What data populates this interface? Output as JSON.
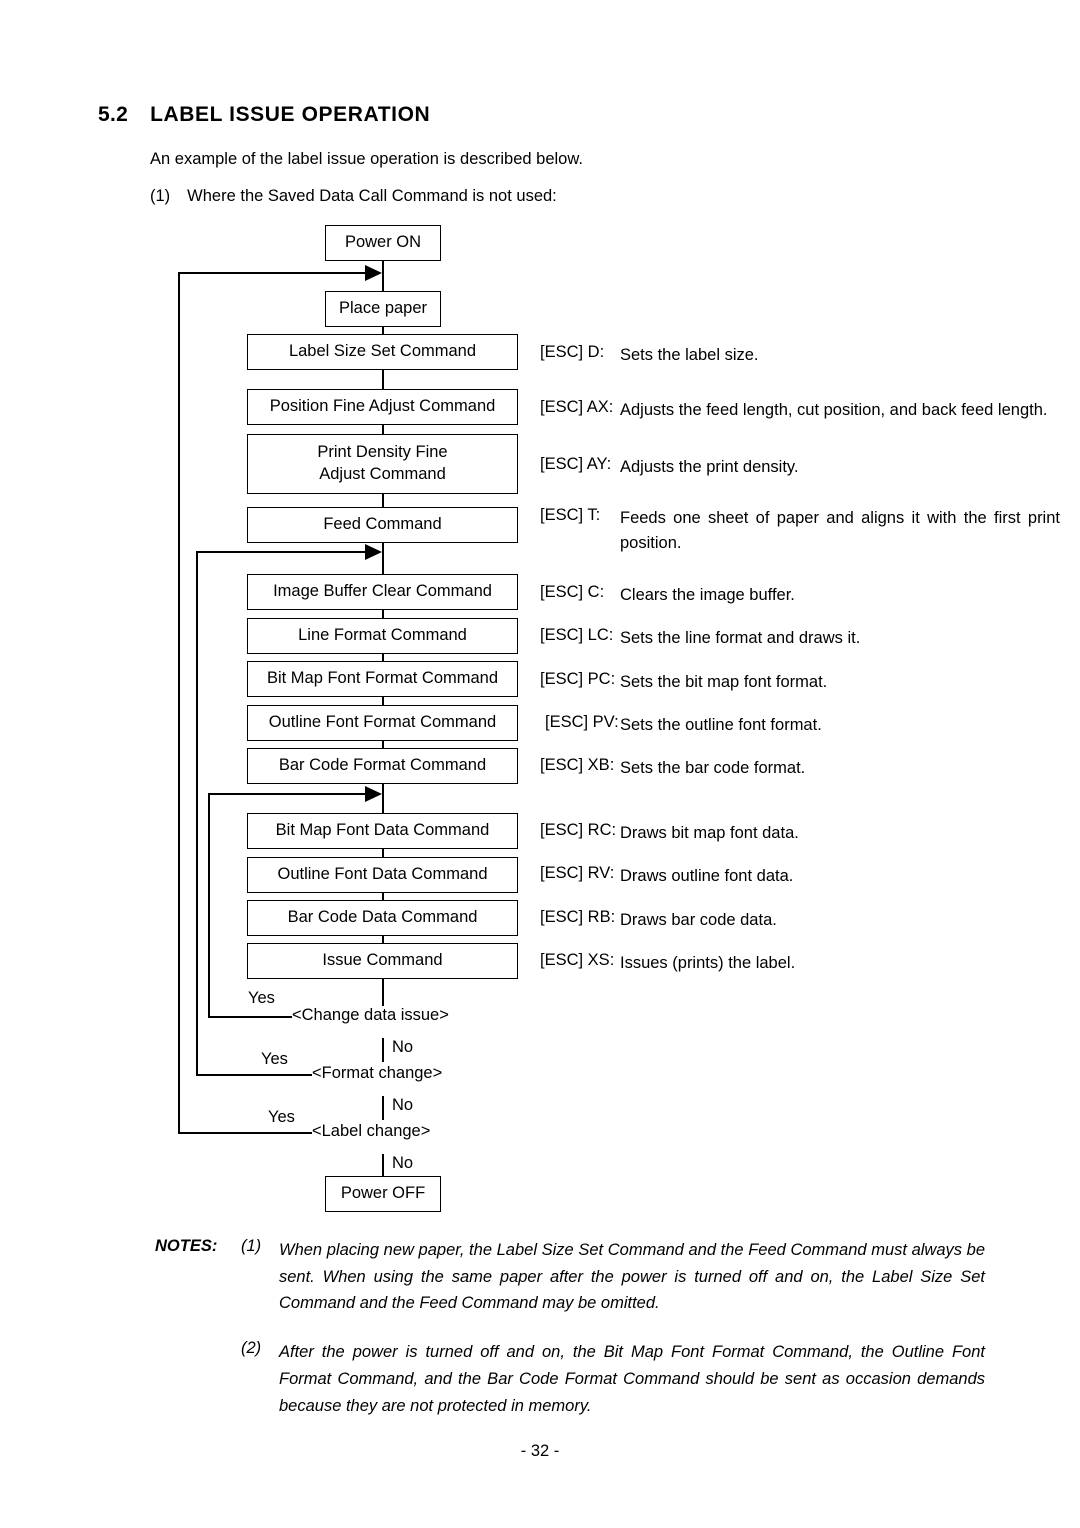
{
  "section": {
    "number": "5.2",
    "title": "LABEL ISSUE OPERATION"
  },
  "intro": {
    "line1": "An example of the label issue operation is described below.",
    "item_number": "(1)",
    "item_text": "Where the Saved Data Call Command is not used:"
  },
  "flowchart": {
    "boxes": [
      {
        "id": "power-on",
        "label": "Power ON"
      },
      {
        "id": "place-paper",
        "label": "Place paper"
      },
      {
        "id": "label-size-set",
        "label": "Label Size Set Command"
      },
      {
        "id": "position-fine-adjust",
        "label": "Position Fine Adjust Command"
      },
      {
        "id": "print-density-line1",
        "label": "Print Density Fine"
      },
      {
        "id": "print-density-line2",
        "label": "Adjust Command"
      },
      {
        "id": "feed",
        "label": "Feed Command"
      },
      {
        "id": "image-buffer-clear",
        "label": "Image Buffer Clear Command"
      },
      {
        "id": "line-format",
        "label": "Line Format Command"
      },
      {
        "id": "bitmap-font-format",
        "label": "Bit Map Font Format Command"
      },
      {
        "id": "outline-font-format",
        "label": "Outline Font Format Command"
      },
      {
        "id": "barcode-format",
        "label": "Bar Code Format Command"
      },
      {
        "id": "bitmap-font-data",
        "label": "Bit Map Font Data Command"
      },
      {
        "id": "outline-font-data",
        "label": "Outline Font Data Command"
      },
      {
        "id": "barcode-data",
        "label": "Bar Code Data Command"
      },
      {
        "id": "issue",
        "label": "Issue Command"
      },
      {
        "id": "power-off",
        "label": "Power OFF"
      }
    ],
    "decisions": [
      {
        "id": "change-data-issue",
        "label": "<Change data issue>",
        "yes": "Yes",
        "no": "No"
      },
      {
        "id": "format-change",
        "label": "<Format change>",
        "yes": "Yes",
        "no": "No"
      },
      {
        "id": "label-change",
        "label": "<Label change>",
        "yes": "Yes",
        "no": "No"
      }
    ]
  },
  "commands": [
    {
      "code": "[ESC] D:",
      "desc": "Sets the label size."
    },
    {
      "code": "[ESC] AX:",
      "desc": "Adjusts the feed length, cut position, and back feed length."
    },
    {
      "code": "[ESC] AY:",
      "desc": "Adjusts the print density."
    },
    {
      "code": "[ESC] T:",
      "desc": "Feeds one sheet of paper and aligns it with the first print position."
    },
    {
      "code": "[ESC] C:",
      "desc": "Clears the image buffer."
    },
    {
      "code": "[ESC] LC:",
      "desc": "Sets the line format and draws it."
    },
    {
      "code": "[ESC] PC:",
      "desc": "Sets the bit map font format."
    },
    {
      "code": "[ESC] PV:",
      "desc": "Sets the outline font format."
    },
    {
      "code": "[ESC] XB:",
      "desc": "Sets the bar code format."
    },
    {
      "code": "[ESC] RC:",
      "desc": "Draws bit map font data."
    },
    {
      "code": "[ESC] RV:",
      "desc": "Draws outline font data."
    },
    {
      "code": "[ESC] RB:",
      "desc": "Draws bar code data."
    },
    {
      "code": "[ESC] XS:",
      "desc": "Issues (prints) the label."
    }
  ],
  "notes": {
    "heading": "NOTES:",
    "items": [
      {
        "number": "(1)",
        "text": "When placing new paper, the Label Size Set Command and the Feed Command must always be sent.    When using the same paper after the power is turned off and on, the Label Size Set Command and the Feed Command may be omitted."
      },
      {
        "number": "(2)",
        "text": "After the power is turned off and on, the Bit Map Font Format Command, the Outline Font Format Command, and the Bar Code Format Command should be sent as occasion demands because they are not protected in memory."
      }
    ]
  },
  "footer": {
    "page_number": "- 32 -"
  }
}
